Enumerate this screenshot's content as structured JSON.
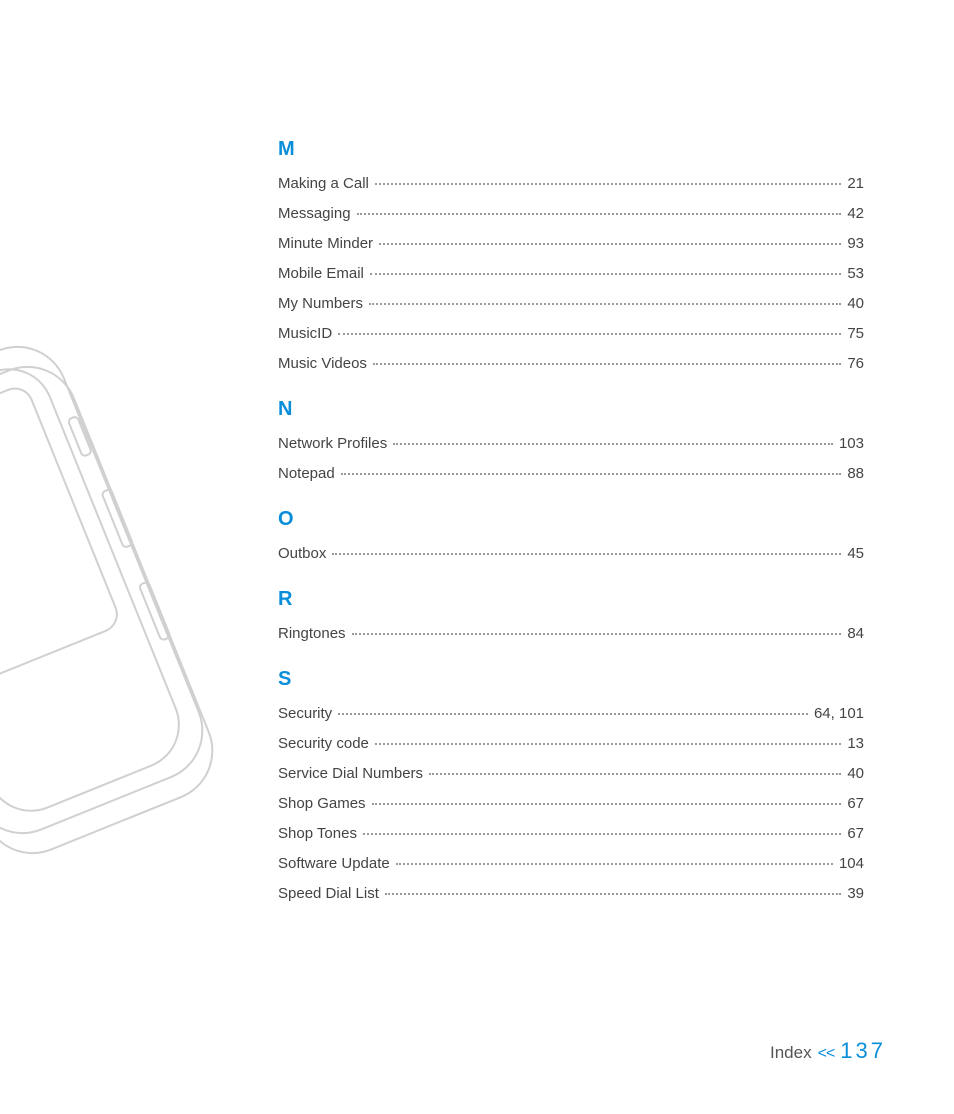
{
  "colors": {
    "accent": "#0a8ed9"
  },
  "sections": [
    {
      "letter": "M",
      "entries": [
        {
          "label": "Making a Call",
          "page": "21"
        },
        {
          "label": "Messaging",
          "page": "42"
        },
        {
          "label": "Minute Minder",
          "page": "93"
        },
        {
          "label": "Mobile Email",
          "page": "53"
        },
        {
          "label": "My Numbers",
          "page": "40"
        },
        {
          "label": "MusicID",
          "page": "75"
        },
        {
          "label": "Music Videos",
          "page": "76"
        }
      ]
    },
    {
      "letter": "N",
      "entries": [
        {
          "label": "Network Profiles",
          "page": "103"
        },
        {
          "label": "Notepad",
          "page": "88"
        }
      ]
    },
    {
      "letter": "O",
      "entries": [
        {
          "label": "Outbox",
          "page": "45"
        }
      ]
    },
    {
      "letter": "R",
      "entries": [
        {
          "label": "Ringtones",
          "page": "84"
        }
      ]
    },
    {
      "letter": "S",
      "entries": [
        {
          "label": "Security",
          "page": "64, 101"
        },
        {
          "label": "Security code",
          "page": "13"
        },
        {
          "label": "Service Dial Numbers",
          "page": "40"
        },
        {
          "label": "Shop Games",
          "page": "67"
        },
        {
          "label": "Shop Tones",
          "page": "67"
        },
        {
          "label": "Software Update",
          "page": "104"
        },
        {
          "label": "Speed Dial List",
          "page": "39"
        }
      ]
    }
  ],
  "footer": {
    "label": "Index",
    "arrows": "<<",
    "page": "137"
  }
}
